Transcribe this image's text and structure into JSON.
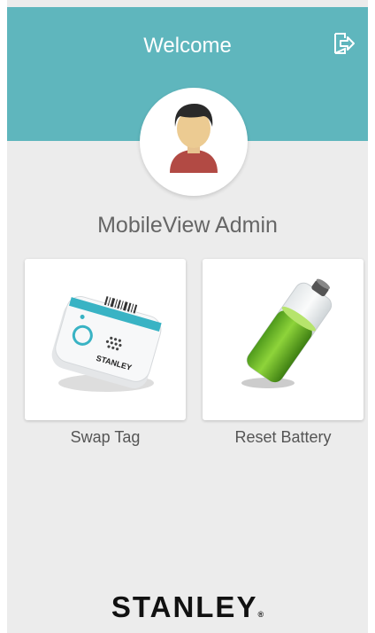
{
  "header": {
    "title": "Welcome",
    "logout_icon": "logout-icon",
    "background_color": "#5fb6bd"
  },
  "user": {
    "name": "MobileView Admin",
    "avatar_icon": "user-avatar-icon"
  },
  "tiles": [
    {
      "label": "Swap Tag",
      "image_icon": "asset-tag-device-icon"
    },
    {
      "label": "Reset Battery",
      "image_icon": "battery-icon"
    }
  ],
  "tag_device": {
    "brand_text": "STANLEY"
  },
  "footer": {
    "brand": "STANLEY",
    "registered_mark": "®"
  }
}
